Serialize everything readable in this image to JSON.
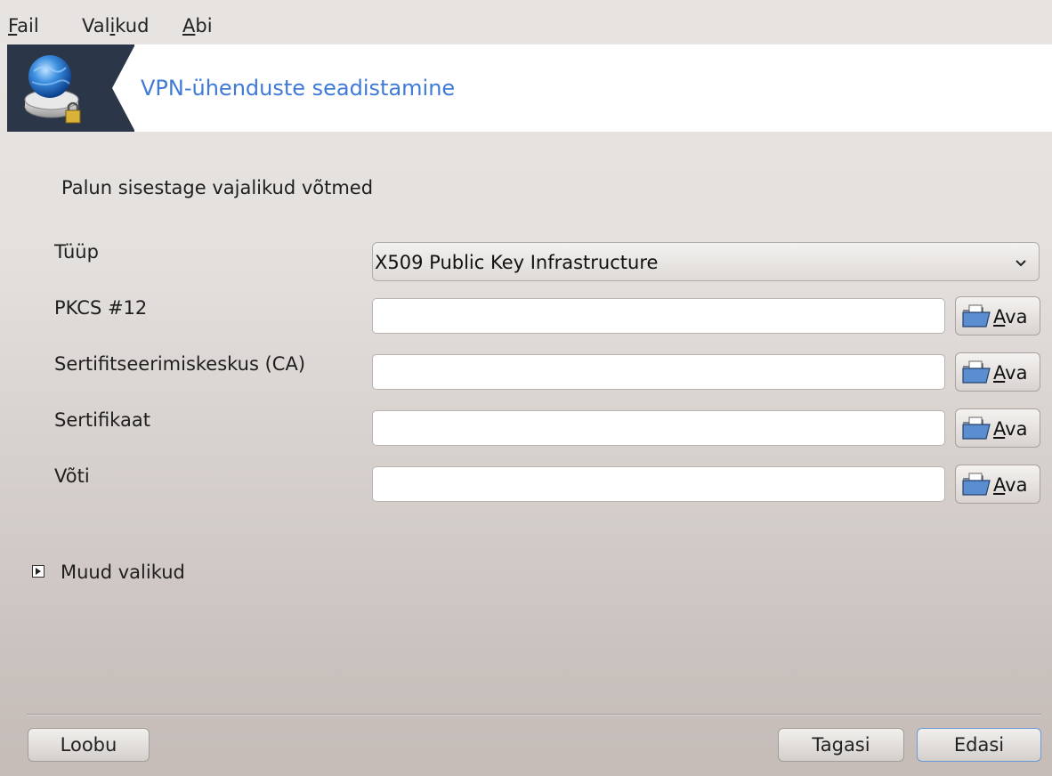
{
  "menu": {
    "file": {
      "accel": "F",
      "rest": "ail"
    },
    "options": {
      "pre": "Val",
      "accel": "i",
      "rest": "kud"
    },
    "help": {
      "accel": "A",
      "rest": "bi"
    }
  },
  "banner": {
    "icon": "vpn-globe-lock-icon",
    "title": "VPN-ühenduste seadistamine"
  },
  "form": {
    "heading": "Palun sisestage vajalikud võtmed",
    "type_label": "Tüüp",
    "type_value": "X509 Public Key Infrastructure",
    "fields": [
      {
        "label": "PKCS #12",
        "value": ""
      },
      {
        "label": "Sertifitseerimiskeskus (CA)",
        "value": ""
      },
      {
        "label": "Sertifikaat",
        "value": ""
      },
      {
        "label": "Võti",
        "value": ""
      }
    ],
    "open_button": {
      "accel": "A",
      "rest": "va",
      "icon": "folder-open-icon"
    }
  },
  "expander": {
    "label": "Muud valikud",
    "icon": "expander-arrow-icon"
  },
  "footer": {
    "cancel": "Loobu",
    "back": "Tagasi",
    "next": "Edasi"
  }
}
